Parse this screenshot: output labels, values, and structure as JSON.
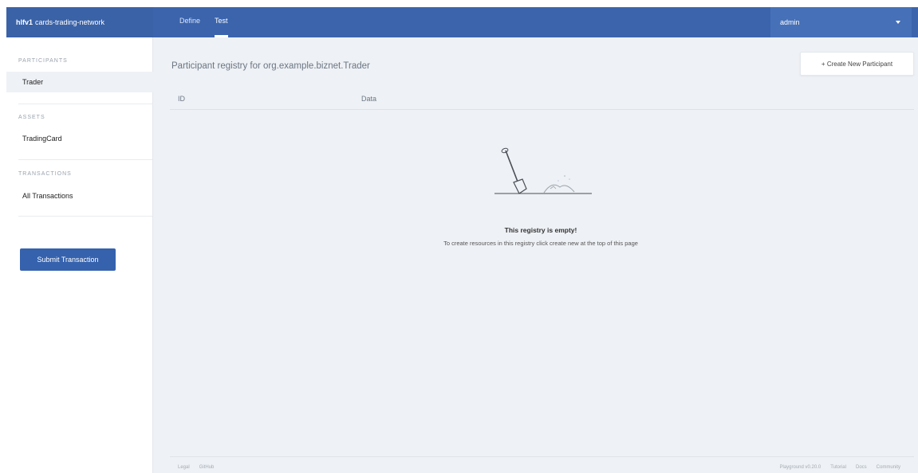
{
  "header": {
    "brand_prefix": "hlfv1",
    "brand_name": "cards-trading-network",
    "tabs": [
      {
        "label": "Define",
        "active": false
      },
      {
        "label": "Test",
        "active": true
      }
    ],
    "user": "admin"
  },
  "sidebar": {
    "participants_title": "PARTICIPANTS",
    "participants": [
      {
        "label": "Trader",
        "selected": true
      }
    ],
    "assets_title": "ASSETS",
    "assets": [
      {
        "label": "TradingCard",
        "selected": false
      }
    ],
    "transactions_title": "TRANSACTIONS",
    "transactions": [
      {
        "label": "All Transactions",
        "selected": false
      }
    ],
    "submit_label": "Submit Transaction"
  },
  "main": {
    "title": "Participant registry for org.example.biznet.Trader",
    "create_label": "+ Create New Participant",
    "columns": [
      "ID",
      "Data"
    ],
    "empty_title": "This registry is empty!",
    "empty_text": "To create resources in this registry click create new at the top of this page"
  },
  "footer": {
    "left": [
      "Legal",
      "GitHub"
    ],
    "right": [
      "Playground v0.20.0",
      "Tutorial",
      "Docs",
      "Community"
    ]
  },
  "colors": {
    "primary": "#3b64ad",
    "background": "#eef1f5"
  }
}
